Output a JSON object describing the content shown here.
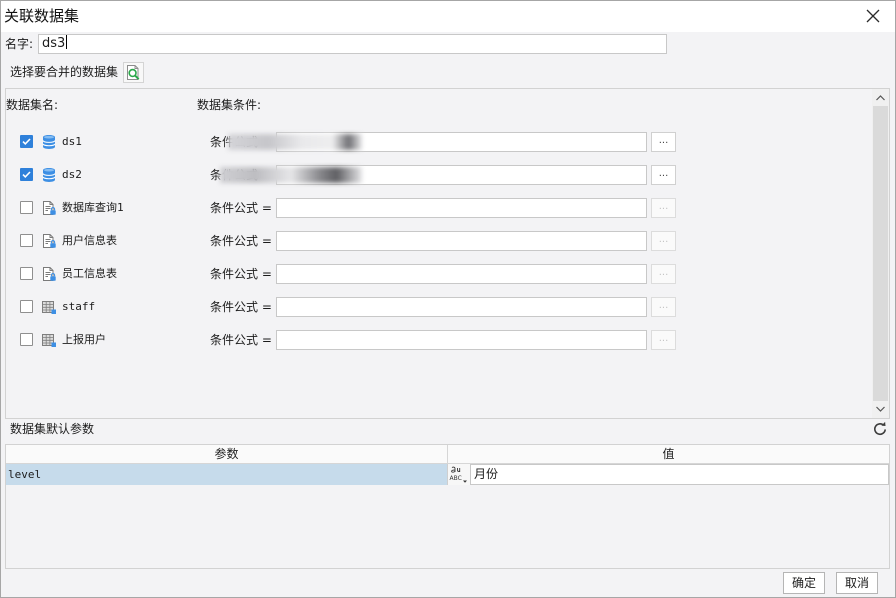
{
  "dialog": {
    "title": "关联数据集",
    "close_icon": "close-icon"
  },
  "name_field": {
    "label": "名字:",
    "value": "ds3"
  },
  "merge": {
    "label": "选择要合并的数据集",
    "button_icon": "dataset-preview-icon"
  },
  "datasets": {
    "name_header": "数据集名:",
    "condition_header": "数据集条件:",
    "rows": [
      {
        "checked": true,
        "icon": "database-icon",
        "name": "ds1",
        "condition_label": "条件公式 =",
        "condition_value": "",
        "more_label": "...",
        "more_enabled": true,
        "redacted": true
      },
      {
        "checked": true,
        "icon": "database-icon",
        "name": "ds2",
        "condition_label": "条件公式 =",
        "condition_value": "",
        "more_label": "...",
        "more_enabled": true,
        "redacted": true
      },
      {
        "checked": false,
        "icon": "server-dataset-icon",
        "name": "数据库查询1",
        "condition_label": "条件公式 =",
        "condition_value": "",
        "more_label": "...",
        "more_enabled": false,
        "redacted": false
      },
      {
        "checked": false,
        "icon": "server-dataset-icon",
        "name": "用户信息表",
        "condition_label": "条件公式 =",
        "condition_value": "",
        "more_label": "...",
        "more_enabled": false,
        "redacted": false
      },
      {
        "checked": false,
        "icon": "server-dataset-icon",
        "name": "员工信息表",
        "condition_label": "条件公式 =",
        "condition_value": "",
        "more_label": "...",
        "more_enabled": false,
        "redacted": false
      },
      {
        "checked": false,
        "icon": "table-icon",
        "name": "staff",
        "condition_label": "条件公式 =",
        "condition_value": "",
        "more_label": "...",
        "more_enabled": false,
        "redacted": false
      },
      {
        "checked": false,
        "icon": "table-icon",
        "name": "上报用户",
        "condition_label": "条件公式 =",
        "condition_value": "",
        "more_label": "...",
        "more_enabled": false,
        "redacted": false
      }
    ]
  },
  "params": {
    "title": "数据集默认参数",
    "refresh_icon": "refresh-icon",
    "header_param": "参数",
    "header_value": "值",
    "rows": [
      {
        "name": "level",
        "type_icon": "string-type-icon",
        "type_caption": "ABC",
        "value": "月份"
      }
    ]
  },
  "buttons": {
    "ok": "确定",
    "cancel": "取消"
  },
  "colors": {
    "accent": "#2e80da",
    "selected_row": "#c6dbeb",
    "title_bar": "#ffffff",
    "body": "#f3f3f5"
  }
}
